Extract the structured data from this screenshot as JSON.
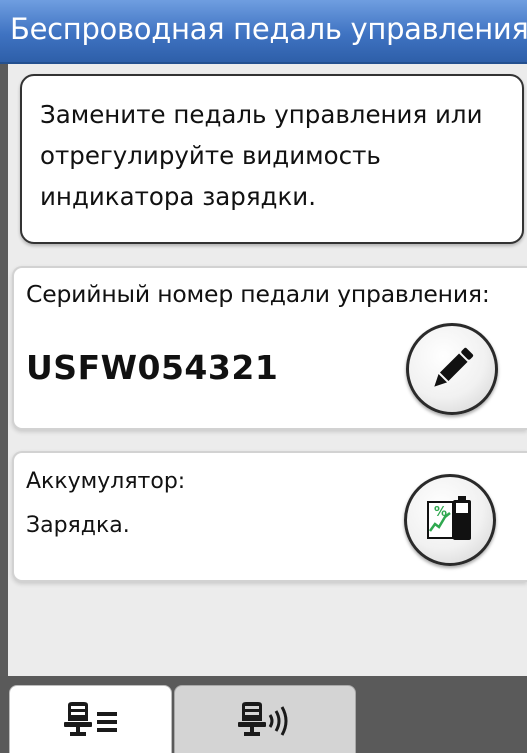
{
  "header": {
    "title": "Беспроводная педаль управления"
  },
  "message": {
    "text": "Замените педаль управления или\nотрегулируйте видимость\nиндикатора зарядки."
  },
  "serial": {
    "label": "Серийный номер педали управления:",
    "value": "USFW054321",
    "edit_icon": "pencil-icon"
  },
  "battery": {
    "label": "Аккумулятор:",
    "status": "Зарядка.",
    "icon": "battery-charging-icon",
    "icon_percent_symbol": "%"
  },
  "tabs": [
    {
      "icon": "pedal-settings-icon",
      "selected": true
    },
    {
      "icon": "pedal-wireless-icon",
      "selected": false
    }
  ],
  "colors": {
    "title_bar": "#3f73c2",
    "tab_bar": "#5a5a5a",
    "accent_green": "#2fa84f"
  }
}
